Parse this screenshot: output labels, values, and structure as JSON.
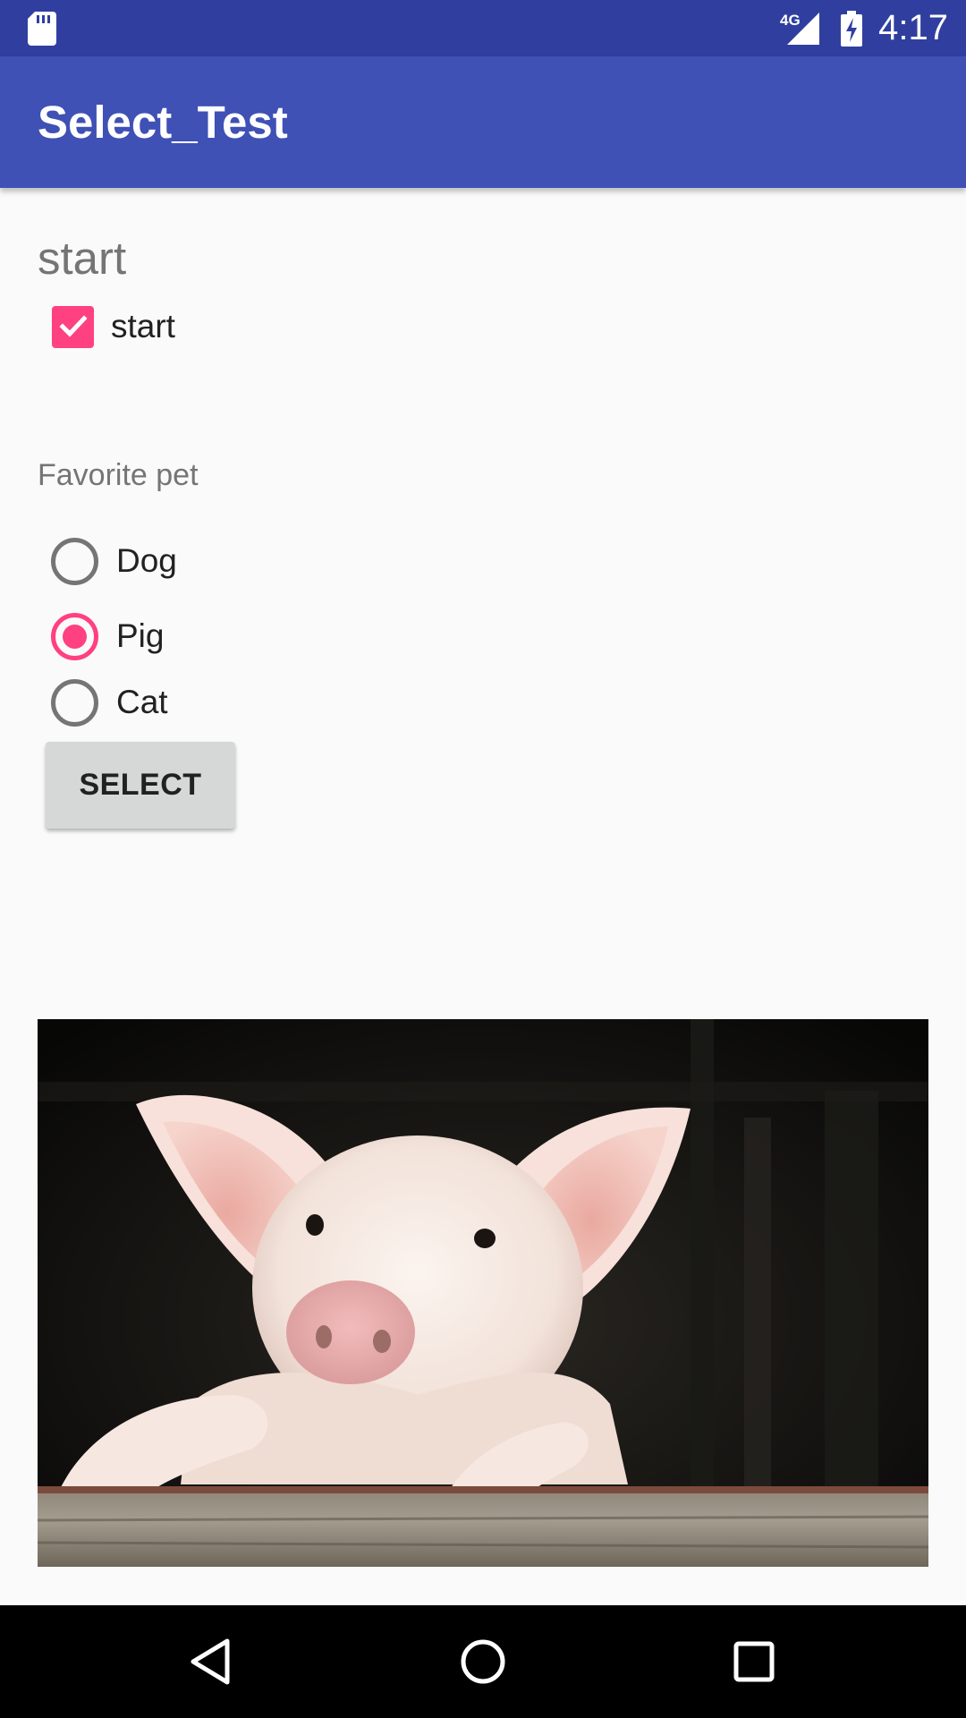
{
  "status_bar": {
    "time": "4:17",
    "network_label": "4G",
    "icons": [
      "sd-card-icon",
      "signal-icon",
      "battery-charging-icon"
    ]
  },
  "app": {
    "title": "Select_Test"
  },
  "start_section": {
    "heading": "start",
    "checkbox": {
      "label": "start",
      "checked": true
    }
  },
  "pet_section": {
    "label": "Favorite pet",
    "options": [
      {
        "label": "Dog",
        "selected": false
      },
      {
        "label": "Pig",
        "selected": true
      },
      {
        "label": "Cat",
        "selected": false
      }
    ],
    "button_label": "SELECT"
  },
  "image": {
    "subject": "pig-photo"
  },
  "nav_bar": {
    "buttons": [
      "back-icon",
      "home-icon",
      "recents-icon"
    ]
  },
  "colors": {
    "status_bar": "#303f9f",
    "toolbar": "#3f51b5",
    "accent": "#ff4081",
    "background": "#fafafa"
  }
}
